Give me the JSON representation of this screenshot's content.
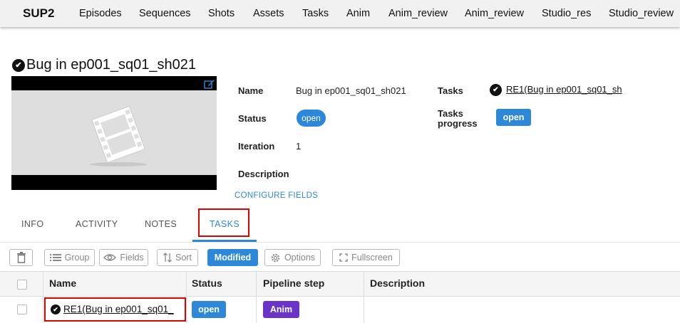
{
  "topbar": {
    "brand": "SUP2",
    "nav": [
      "Episodes",
      "Sequences",
      "Shots",
      "Assets",
      "Tasks",
      "Anim",
      "Anim_review",
      "Anim_review",
      "Studio_res",
      "Studio_review"
    ]
  },
  "entity": {
    "title": "Bug in ep001_sq01_sh021",
    "fields": {
      "name_label": "Name",
      "name_value": "Bug in ep001_sq01_sh021",
      "status_label": "Status",
      "status_value": "open",
      "iteration_label": "Iteration",
      "iteration_value": "1",
      "description_label": "Description",
      "tasks_label": "Tasks",
      "tasks_link": "RE1(Bug in ep001_sq01_sh",
      "tasks_progress_label_1": "Tasks",
      "tasks_progress_label_2": "progress",
      "tasks_progress_value": "open"
    },
    "configure_fields": "CONFIGURE FIELDS"
  },
  "tabs": [
    "INFO",
    "ACTIVITY",
    "NOTES",
    "TASKS"
  ],
  "active_tab": "TASKS",
  "toolbar": {
    "group": "Group",
    "fields": "Fields",
    "sort": "Sort",
    "modified": "Modified",
    "options": "Options",
    "fullscreen": "Fullscreen"
  },
  "table": {
    "columns": [
      "Name",
      "Status",
      "Pipeline step",
      "Description"
    ],
    "rows": [
      {
        "name": "RE1(Bug in ep001_sq01_",
        "status": "open",
        "pipeline_step": "Anim",
        "description": ""
      }
    ]
  },
  "colors": {
    "accent": "#2d88d9",
    "anim_step": "#6b34c8",
    "highlight": "#e00000"
  },
  "icons": [
    "check-circle-icon",
    "edit-icon",
    "film-placeholder-icon",
    "trash-icon",
    "list-icon",
    "eye-icon",
    "sort-icon",
    "gear-icon",
    "fullscreen-icon"
  ]
}
